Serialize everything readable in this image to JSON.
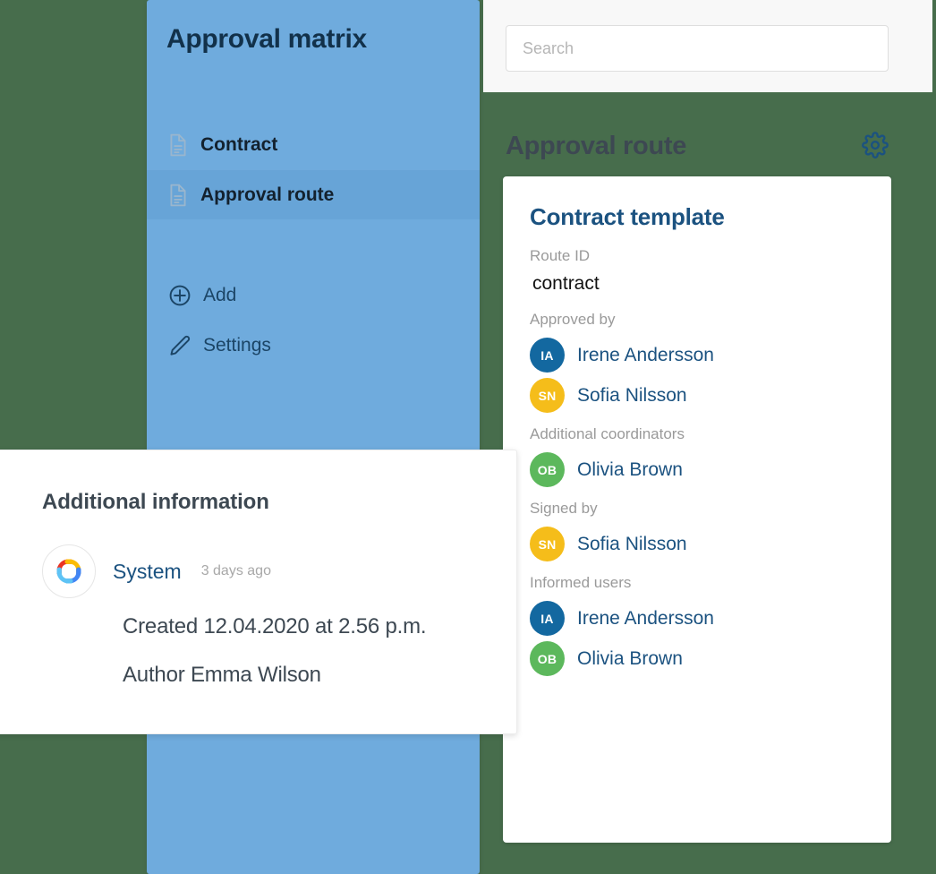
{
  "background_color": "#476d4c",
  "search": {
    "placeholder": "Search",
    "value": ""
  },
  "sidebar": {
    "title": "Approval matrix",
    "accent_color": "#6fabdd",
    "nav_items": [
      {
        "label": "Contract",
        "icon": "document-icon",
        "selected": false
      },
      {
        "label": "Approval route",
        "icon": "document-icon",
        "selected": true
      }
    ],
    "actions": [
      {
        "label": "Add",
        "icon": "plus-circle-icon"
      },
      {
        "label": "Settings",
        "icon": "pencil-icon"
      }
    ]
  },
  "route_panel": {
    "title": "Approval route",
    "settings_icon": "gear-icon",
    "card": {
      "title": "Contract template",
      "title_color": "#1b5280",
      "route_id_label": "Route ID",
      "route_id_value": "contract",
      "groups": [
        {
          "label": "Approved by",
          "people": [
            {
              "initials": "IA",
              "name": "Irene Andersson",
              "color": "#1368a0"
            },
            {
              "initials": "SN",
              "name": "Sofia Nilsson",
              "color": "#f5bd1a"
            }
          ]
        },
        {
          "label": "Additional coordinators",
          "people": [
            {
              "initials": "OB",
              "name": "Olivia Brown",
              "color": "#5cb85c"
            }
          ]
        },
        {
          "label": "Signed by",
          "people": [
            {
              "initials": "SN",
              "name": "Sofia Nilsson",
              "color": "#f5bd1a"
            }
          ]
        },
        {
          "label": "Informed users",
          "people": [
            {
              "initials": "IA",
              "name": "Irene Andersson",
              "color": "#1368a0"
            },
            {
              "initials": "OB",
              "name": "Olivia Brown",
              "color": "#5cb85c"
            }
          ]
        }
      ]
    }
  },
  "info_card": {
    "title": "Additional information",
    "logo_icon": "system-pinwheel-logo",
    "author_name": "System",
    "timestamp": "3 days ago",
    "lines": [
      "Created 12.04.2020 at 2.56 p.m.",
      "Author Emma Wilson"
    ]
  }
}
